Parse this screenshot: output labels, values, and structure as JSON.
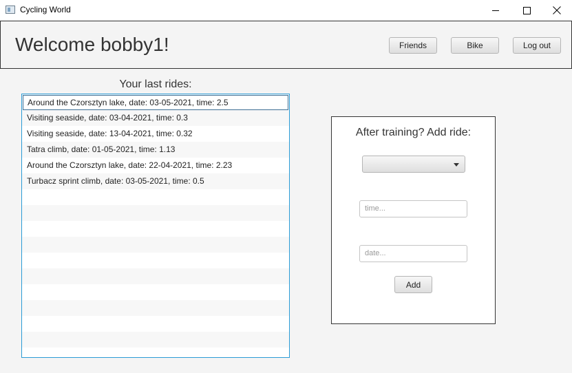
{
  "window": {
    "title": "Cycling World"
  },
  "header": {
    "welcome": "Welcome bobby1!",
    "buttons": {
      "friends": "Friends",
      "bike": "Bike",
      "logout": "Log out"
    }
  },
  "rides": {
    "title": "Your last rides:",
    "items": [
      "Around the Czorsztyn lake, date: 03-05-2021, time: 2.5",
      "Visiting seaside, date: 03-04-2021, time: 0.3",
      "Visiting seaside, date: 13-04-2021, time: 0.32",
      "Tatra climb, date: 01-05-2021, time: 1.13",
      "Around the Czorsztyn lake, date: 22-04-2021, time: 2.23",
      "Turbacz sprint climb, date: 03-05-2021, time: 0.5"
    ],
    "selected_index": 0
  },
  "add_ride": {
    "title": "After training? Add ride:",
    "route_value": "",
    "time_placeholder": "time...",
    "date_placeholder": "date...",
    "add_label": "Add"
  }
}
